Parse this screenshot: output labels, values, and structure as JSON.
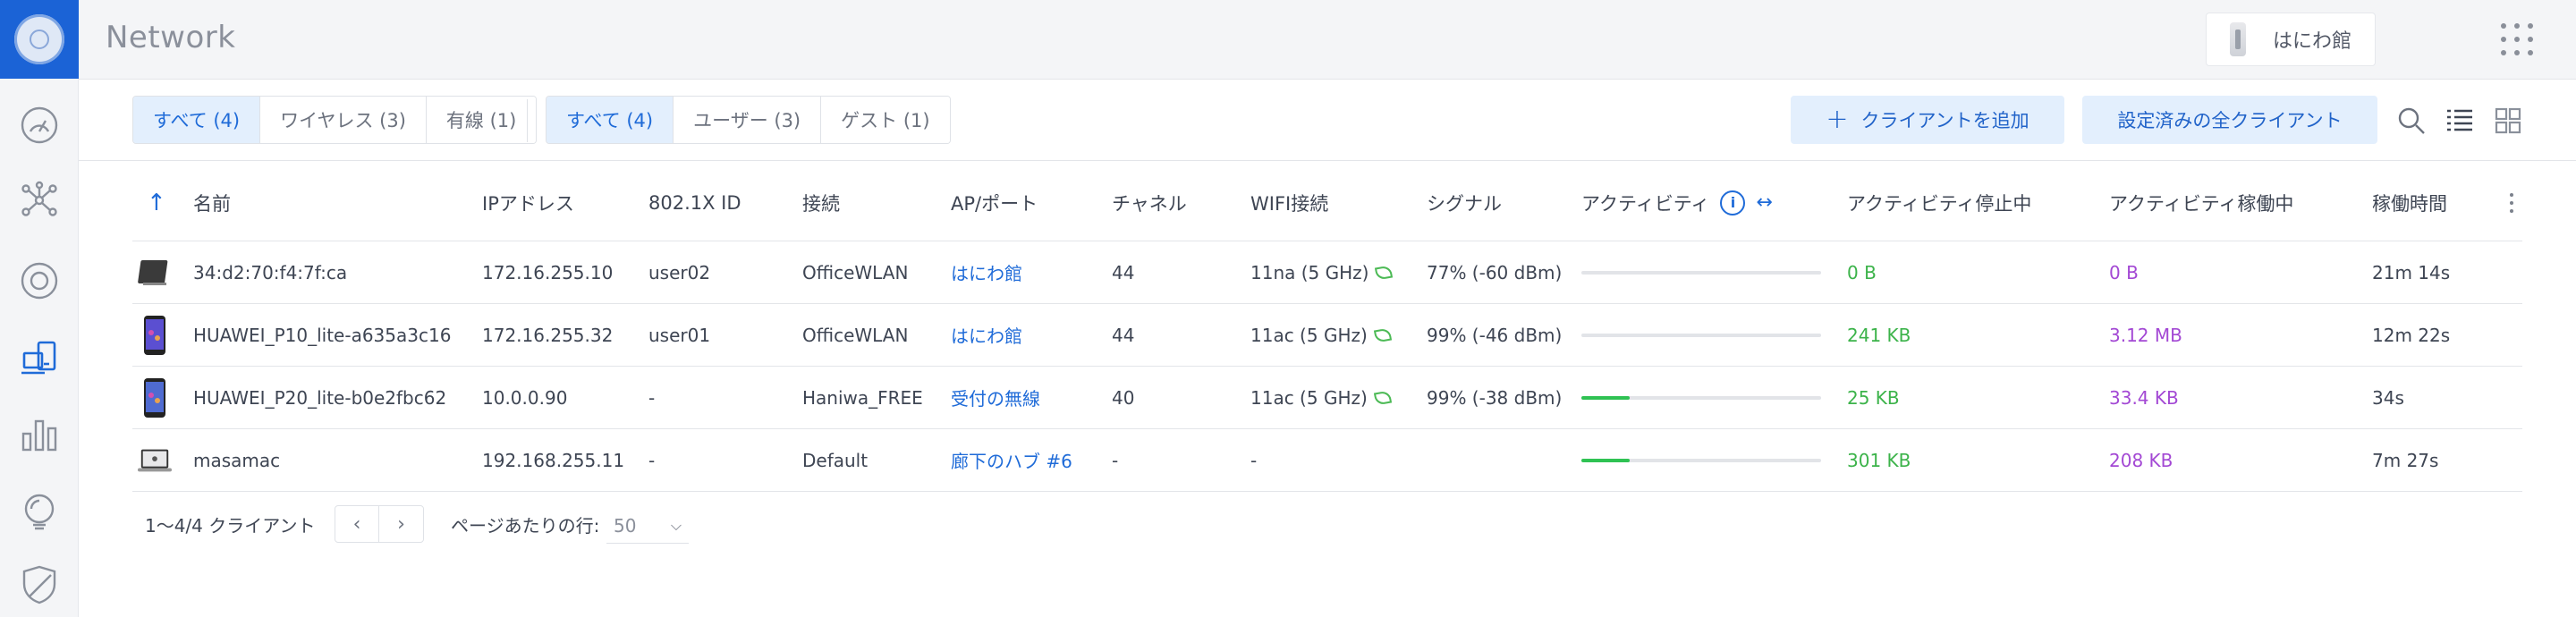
{
  "header": {
    "title": "Network",
    "site_name": "はにわ館"
  },
  "filters": {
    "connection": [
      {
        "label": "すべて (4)",
        "selected": true
      },
      {
        "label": "ワイヤレス (3)",
        "selected": false
      },
      {
        "label": "有線 (1)",
        "selected": false
      }
    ],
    "user_type": [
      {
        "label": "すべて (4)",
        "selected": true
      },
      {
        "label": "ユーザー (3)",
        "selected": false
      },
      {
        "label": "ゲスト (1)",
        "selected": false
      }
    ],
    "add_client_label": "クライアントを追加",
    "configured_clients_label": "設定済みの全クライアント"
  },
  "table": {
    "columns": [
      "名前",
      "IPアドレス",
      "802.1X ID",
      "接続",
      "AP/ポート",
      "チャネル",
      "WIFI接続",
      "シグナル",
      "アクティビティ",
      "アクティビティ停止中",
      "アクティビティ稼働中",
      "稼働時間"
    ],
    "rows": [
      {
        "device": "tablet",
        "name": "34:d2:70:f4:7f:ca",
        "ip": "172.16.255.10",
        "id": "user02",
        "network": "OfficeWLAN",
        "ap": "はにわ館",
        "channel": "44",
        "wifi": "11na (5 GHz)",
        "signal": "77% (-60 dBm)",
        "activity": 0.0,
        "down": "0 B",
        "up": "0 B",
        "uptime": "21m 14s"
      },
      {
        "device": "phone",
        "name": "HUAWEI_P10_lite-a635a3c16",
        "ip": "172.16.255.32",
        "id": "user01",
        "network": "OfficeWLAN",
        "ap": "はにわ館",
        "channel": "44",
        "wifi": "11ac (5 GHz)",
        "signal": "99% (-46 dBm)",
        "activity": 0.0,
        "down": "241 KB",
        "up": "3.12 MB",
        "uptime": "12m 22s"
      },
      {
        "device": "phone",
        "name": "HUAWEI_P20_lite-b0e2fbc62",
        "ip": "10.0.0.90",
        "id": "-",
        "network": "Haniwa_FREE",
        "ap": "受付の無線",
        "channel": "40",
        "wifi": "11ac (5 GHz)",
        "signal": "99% (-38 dBm)",
        "activity": 0.2,
        "down": "25 KB",
        "up": "33.4 KB",
        "uptime": "34s"
      },
      {
        "device": "laptop",
        "name": "masamac",
        "ip": "192.168.255.11",
        "id": "-",
        "network": "Default",
        "ap": "廊下のハブ #6",
        "channel": "-",
        "wifi": "-",
        "signal": "",
        "activity": 0.2,
        "down": "301 KB",
        "up": "208 KB",
        "uptime": "7m 27s"
      }
    ]
  },
  "footer": {
    "count": "1〜4/4 クライアント",
    "rows_per_page_label": "ページあたりの行:",
    "rows_per_page_value": "50"
  },
  "colors": {
    "accent": "#1f6bd8",
    "down": "#3cb34a",
    "up": "#a348d4"
  }
}
